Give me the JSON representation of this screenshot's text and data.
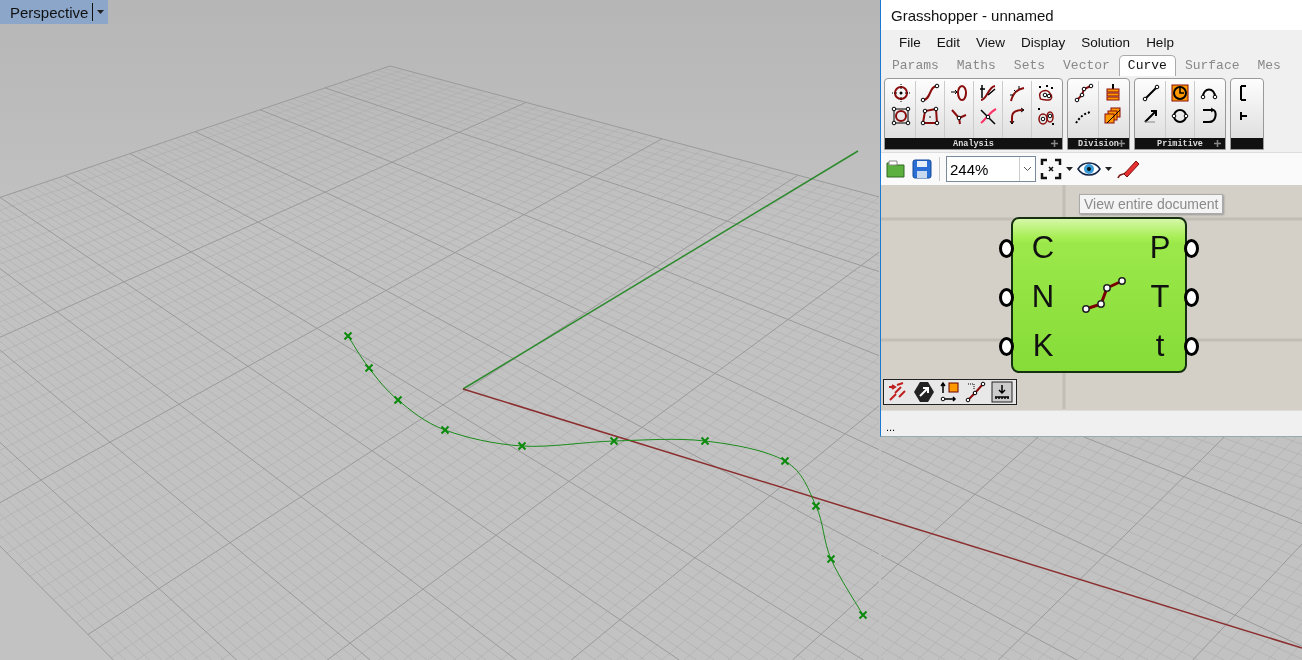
{
  "viewport": {
    "label": "Perspective"
  },
  "window": {
    "title": "Grasshopper - unnamed"
  },
  "menu": [
    "File",
    "Edit",
    "View",
    "Display",
    "Solution",
    "Help"
  ],
  "tabs": [
    {
      "label": "Params",
      "selected": false
    },
    {
      "label": "Maths",
      "selected": false
    },
    {
      "label": "Sets",
      "selected": false
    },
    {
      "label": "Vector",
      "selected": false
    },
    {
      "label": "Curve",
      "selected": true
    },
    {
      "label": "Surface",
      "selected": false
    },
    {
      "label": "Mes",
      "selected": false
    }
  ],
  "ribbon_groups": [
    {
      "label": "Analysis"
    },
    {
      "label": "Division"
    },
    {
      "label": "Primitive"
    }
  ],
  "toolbar": {
    "zoom": "244%"
  },
  "tooltip": "View entire document",
  "component": {
    "inputs": [
      "C",
      "N",
      "K"
    ],
    "outputs": [
      "P",
      "T",
      "t"
    ]
  },
  "status_bar": "..."
}
